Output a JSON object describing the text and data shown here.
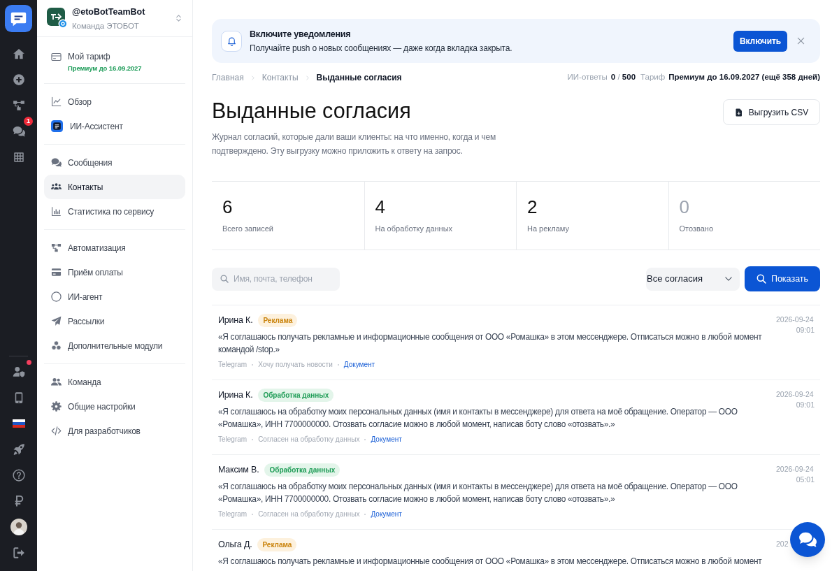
{
  "rail": {
    "chat_badge": "1",
    "team_alert": true
  },
  "workspace": {
    "bot_name": "@etoBotTeamBot",
    "team": "Команда ЭТОБОТ"
  },
  "sidebar": {
    "sections": [
      {
        "items": [
          {
            "label": "Мой тариф",
            "sublabel": "Премиум до 16.09.2027",
            "selected": false
          }
        ]
      },
      {
        "items": [
          {
            "label": "Обзор",
            "selected": false
          },
          {
            "label": "ИИ-Ассистент",
            "selected": false
          }
        ]
      },
      {
        "items": [
          {
            "label": "Сообщения",
            "selected": false
          },
          {
            "label": "Контакты",
            "selected": true
          },
          {
            "label": "Статистика по сервису",
            "selected": false
          }
        ]
      },
      {
        "items": [
          {
            "label": "Автоматизация",
            "selected": false
          },
          {
            "label": "Приём оплаты",
            "selected": false
          },
          {
            "label": "ИИ-агент",
            "selected": false
          },
          {
            "label": "Рассылки",
            "selected": false
          },
          {
            "label": "Дополнительные модули",
            "selected": false
          }
        ]
      },
      {
        "items": [
          {
            "label": "Команда",
            "selected": false
          },
          {
            "label": "Общие настройки",
            "selected": false
          },
          {
            "label": "Для разработчиков",
            "selected": false
          }
        ]
      }
    ]
  },
  "notification_banner": {
    "title": "Включите уведомления",
    "text": "Получайте push о новых сообщениях — даже когда вкладка закрыта.",
    "button": "Включить"
  },
  "breadcrumbs": [
    {
      "label": "Главная",
      "current": false
    },
    {
      "label": "Контакты",
      "current": false
    },
    {
      "label": "Выданные согласия",
      "current": true
    }
  ],
  "usage": {
    "ai_label": "ИИ-ответы",
    "ai_count": "**0** / **500**",
    "plan_label": "Тариф",
    "plan": "Премиум до 16.09.2027 (ещё 358 дней)"
  },
  "page": {
    "title": "Выданные согласия",
    "description": "Журнал согласий, которые дали ваши клиенты: на что именно, когда и чем подтверждено. Эту выгрузку можно приложить к ответу на запрос.",
    "export_button": "Выгрузить CSV"
  },
  "stats": [
    {
      "value": "6",
      "label": "Всего записей",
      "muted": false
    },
    {
      "value": "4",
      "label": "На обработку данных",
      "muted": false
    },
    {
      "value": "2",
      "label": "На рекламу",
      "muted": false
    },
    {
      "value": "0",
      "label": "Отозвано",
      "muted": true
    }
  ],
  "filters": {
    "search": {
      "placeholder": "Имя, почта, телефон"
    },
    "type_select": "Все согласия",
    "submit": "Показать"
  },
  "consents": [
    {
      "name": "Ирина К.",
      "tag": {
        "kind": "ads",
        "label": "Реклама"
      },
      "text": "«Я соглашаюсь получать рекламные и информационные сообщения от ООО «Ромашка» в этом мессенджере. Отписаться можно в любой момент командой /stop.»",
      "channel": "Telegram",
      "reason": "Хочу получать новости",
      "link": "Документ",
      "date": "2026-09-24",
      "time": "09:01"
    },
    {
      "name": "Ирина К.",
      "tag": {
        "kind": "data",
        "label": "Обработка данных"
      },
      "text": "«Я соглашаюсь на обработку моих персональных данных (имя и контакты в мессенджере) для ответа на моё обращение. Оператор — ООО «Ромашка», ИНН 7700000000. Отозвать согласие можно в любой момент, написав боту слово «отозвать».»",
      "channel": "Telegram",
      "reason": "Согласен на обработку данных",
      "link": "Документ",
      "date": "2026-09-24",
      "time": "09:01"
    },
    {
      "name": "Максим В.",
      "tag": {
        "kind": "data",
        "label": "Обработка данных"
      },
      "text": "«Я соглашаюсь на обработку моих персональных данных (имя и контакты в мессенджере) для ответа на моё обращение. Оператор — ООО «Ромашка», ИНН 7700000000. Отозвать согласие можно в любой момент, написав боту слово «отозвать».»",
      "channel": "Telegram",
      "reason": "Согласен на обработку данных",
      "link": "Документ",
      "date": "2026-09-24",
      "time": "05:01"
    },
    {
      "name": "Ольга Д.",
      "tag": {
        "kind": "ads",
        "label": "Реклама"
      },
      "text": "«Я соглашаюсь получать рекламные и информационные сообщения от ООО «Ромашка» в этом мессенджере. Отписаться можно в любой момент",
      "date": "202"
    }
  ]
}
